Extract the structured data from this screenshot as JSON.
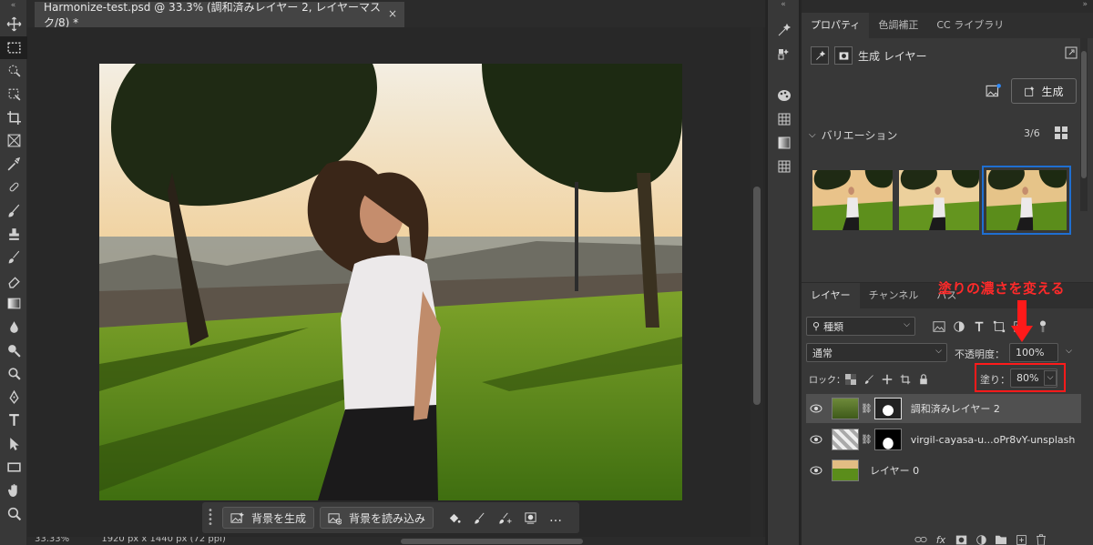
{
  "document": {
    "tab_title": "Harmonize-test.psd @ 33.3% (調和済みレイヤー 2, レイヤーマスク/8) *",
    "close_glyph": "×"
  },
  "status": {
    "zoom": "33.33%",
    "dimensions": "1920 px x 1440 px (72 ppi)"
  },
  "taskbar": {
    "generate_bg": "背景を生成",
    "import_bg": "背景を読み込み",
    "more": "…"
  },
  "properties": {
    "tabs": [
      "プロパティ",
      "色調補正",
      "CC ライブラリ"
    ],
    "layer_type": "生成 レイヤー",
    "generate_button": "生成",
    "variations_label": "バリエーション",
    "variation_count": "3/6"
  },
  "layers": {
    "tabs": [
      "レイヤー",
      "チャンネル",
      "パス"
    ],
    "filter_kind": "種類",
    "blend_mode": "通常",
    "opacity_label": "不透明度：",
    "opacity_value": "100%",
    "lock_label": "ロック：",
    "fill_label": "塗り：",
    "fill_value": "80%",
    "items": [
      {
        "name": "調和済みレイヤー 2",
        "selected": true
      },
      {
        "name": "virgil-cayasa-u...oPr8vY-unsplash",
        "selected": false
      },
      {
        "name": "レイヤー 0",
        "selected": false
      }
    ]
  },
  "annotation": {
    "text": "塗りの濃さを変える",
    "color": "#ff2a2a"
  },
  "colors": {
    "accent_selection": "#1f6fd1",
    "panel_bg": "#383838",
    "canvas_bg": "#282828"
  }
}
